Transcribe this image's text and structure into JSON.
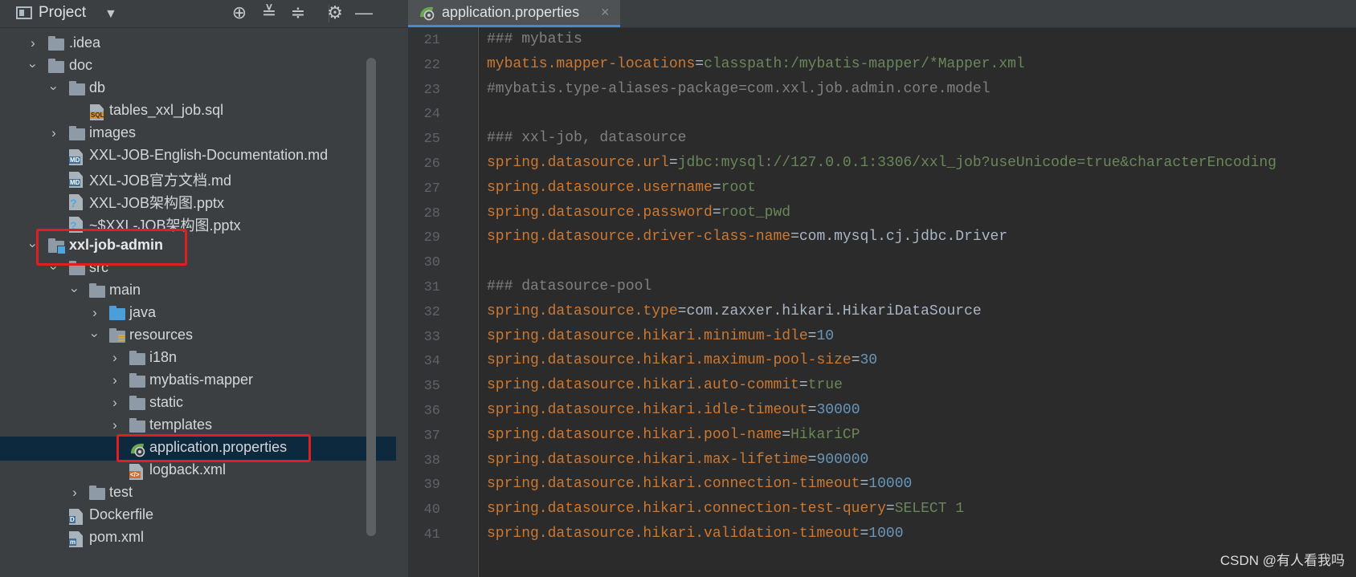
{
  "project_panel": {
    "title": "Project",
    "icons": [
      "project-view-icon",
      "dropdown-arrow-icon",
      "locate-icon",
      "expand-all-icon",
      "collapse-all-icon",
      "settings-gear-icon",
      "hide-minimize-icon"
    ]
  },
  "tree": {
    "clipped_top": "ignore",
    "idea": ".idea",
    "doc": "doc",
    "db": "db",
    "tables_sql": "tables_xxl_job.sql",
    "images": "images",
    "english_doc": "XXL-JOB-English-Documentation.md",
    "official_doc": "XXL-JOB官方文档.md",
    "arch_pptx": "XXL-JOB架构图.pptx",
    "temp_pptx": "~$XXL-JOB架构图.pptx",
    "admin_module": "xxl-job-admin",
    "src": "src",
    "main": "main",
    "java": "java",
    "resources": "resources",
    "i18n": "i18n",
    "mybatis_mapper": "mybatis-mapper",
    "static": "static",
    "templates": "templates",
    "application_properties": "application.properties",
    "logback": "logback.xml",
    "test": "test",
    "dockerfile": "Dockerfile",
    "pom": "pom.xml"
  },
  "editor": {
    "tab_label": "application.properties",
    "lines": [
      {
        "n": "21",
        "comment": "### mybatis"
      },
      {
        "n": "22",
        "key": "mybatis.mapper-locations",
        "value": "classpath:/mybatis-mapper/*Mapper.xml",
        "vtype": "str"
      },
      {
        "n": "23",
        "comment": "#mybatis.type-aliases-package=com.xxl.job.admin.core.model"
      },
      {
        "n": "24"
      },
      {
        "n": "25",
        "comment": "### xxl-job, datasource"
      },
      {
        "n": "26",
        "key": "spring.datasource.url",
        "value": "jdbc:mysql://127.0.0.1:3306/xxl_job?useUnicode=true&characterEncoding",
        "vtype": "str"
      },
      {
        "n": "27",
        "key": "spring.datasource.username",
        "value": "root",
        "vtype": "str"
      },
      {
        "n": "28",
        "key": "spring.datasource.password",
        "value": "root_pwd",
        "vtype": "str"
      },
      {
        "n": "29",
        "key": "spring.datasource.driver-class-name",
        "value": "com.mysql.cj.jdbc.Driver",
        "vtype": "cls"
      },
      {
        "n": "30"
      },
      {
        "n": "31",
        "comment": "### datasource-pool"
      },
      {
        "n": "32",
        "key": "spring.datasource.type",
        "value": "com.zaxxer.hikari.HikariDataSource",
        "vtype": "cls"
      },
      {
        "n": "33",
        "key": "spring.datasource.hikari.minimum-idle",
        "value": "10",
        "vtype": "num"
      },
      {
        "n": "34",
        "key": "spring.datasource.hikari.maximum-pool-size",
        "value": "30",
        "vtype": "num"
      },
      {
        "n": "35",
        "key": "spring.datasource.hikari.auto-commit",
        "value": "true",
        "vtype": "str"
      },
      {
        "n": "36",
        "key": "spring.datasource.hikari.idle-timeout",
        "value": "30000",
        "vtype": "num"
      },
      {
        "n": "37",
        "key": "spring.datasource.hikari.pool-name",
        "value": "HikariCP",
        "vtype": "str"
      },
      {
        "n": "38",
        "key": "spring.datasource.hikari.max-lifetime",
        "value": "900000",
        "vtype": "num"
      },
      {
        "n": "39",
        "key": "spring.datasource.hikari.connection-timeout",
        "value": "10000",
        "vtype": "num"
      },
      {
        "n": "40",
        "key": "spring.datasource.hikari.connection-test-query",
        "value": "SELECT 1",
        "vtype": "str"
      },
      {
        "n": "41",
        "key": "spring.datasource.hikari.validation-timeout",
        "value": "1000",
        "vtype": "num"
      }
    ]
  },
  "watermark": "CSDN @有人看我吗",
  "colors": {
    "panel_bg": "#3c3f41",
    "editor_bg": "#2b2b2b",
    "selection_bg": "#0d293e",
    "highlight_box": "#e02020",
    "key_color": "#cc7832",
    "string_color": "#6a8759",
    "number_color": "#6897bb",
    "comment_color": "#808080"
  }
}
